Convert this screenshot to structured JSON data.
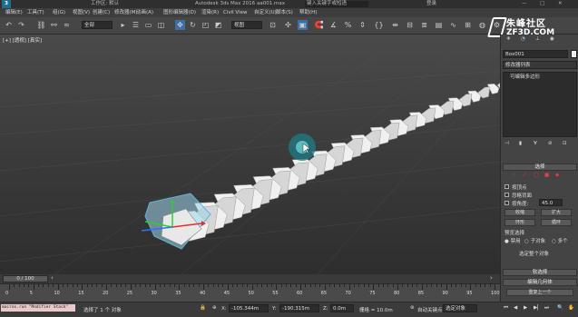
{
  "titlebar": {
    "workspace": "工作区: 默认",
    "title": "Autodesk 3ds Max 2016",
    "file": "aa001.max",
    "search_placeholder": "键入关键字或短语",
    "login": "登录"
  },
  "menubar": {
    "items": [
      "编辑(E)",
      "工具(T)",
      "组(G)",
      "视图(V)",
      "创建(C)",
      "修改器(M)",
      "动画(A)",
      "图形编辑器(D)",
      "渲染(R)",
      "Civil View",
      "自定义(U)",
      "脚本(S)",
      "帮助(H)"
    ]
  },
  "toolbar": {
    "filter_value": "全部",
    "coord_value": "视图"
  },
  "viewport": {
    "label": "[+] [透视] [真实]"
  },
  "watermark": {
    "brand": "朱峰社区",
    "url": "ZF3D.COM"
  },
  "cmdpanel": {
    "object_name": "Box001",
    "modifier_list_label": "修改器列表",
    "stack_item": "可编辑多边形",
    "selection_rollout": "选择",
    "by_vertex": "按顶点",
    "ignore_backfacing": "忽略背面",
    "by_angle": "按角度:",
    "angle_value": "45.0",
    "shrink": "收缩",
    "grow": "扩大",
    "ring": "环形",
    "loop": "循环",
    "preview_selection": "预览选择",
    "preview_off": "禁用",
    "preview_subobj": "子对象",
    "preview_multi": "多个",
    "selected_status": "选定整个对象",
    "soft_selection": "软选择",
    "edit_geometry": "编辑几何体",
    "repeat_last": "重复上一个"
  },
  "timeline": {
    "frame_display": "0 / 100",
    "ticks": [
      "0",
      "5",
      "10",
      "15",
      "20",
      "25",
      "30",
      "35",
      "40",
      "45",
      "50",
      "55",
      "60",
      "65",
      "70",
      "75",
      "80",
      "85",
      "90",
      "95",
      "100"
    ]
  },
  "statusbar": {
    "script": "macros.run \"Modifier Stack\"",
    "selected": "选择了 1 个 对象",
    "x_label": "X:",
    "x_value": "-105.344m",
    "y_label": "Y:",
    "y_value": "-190.315m",
    "z_label": "Z:",
    "z_value": "0.0m",
    "grid_label": "栅格 = 10.0m",
    "autokey": "自动关键点",
    "selection_set": "选定对象"
  }
}
